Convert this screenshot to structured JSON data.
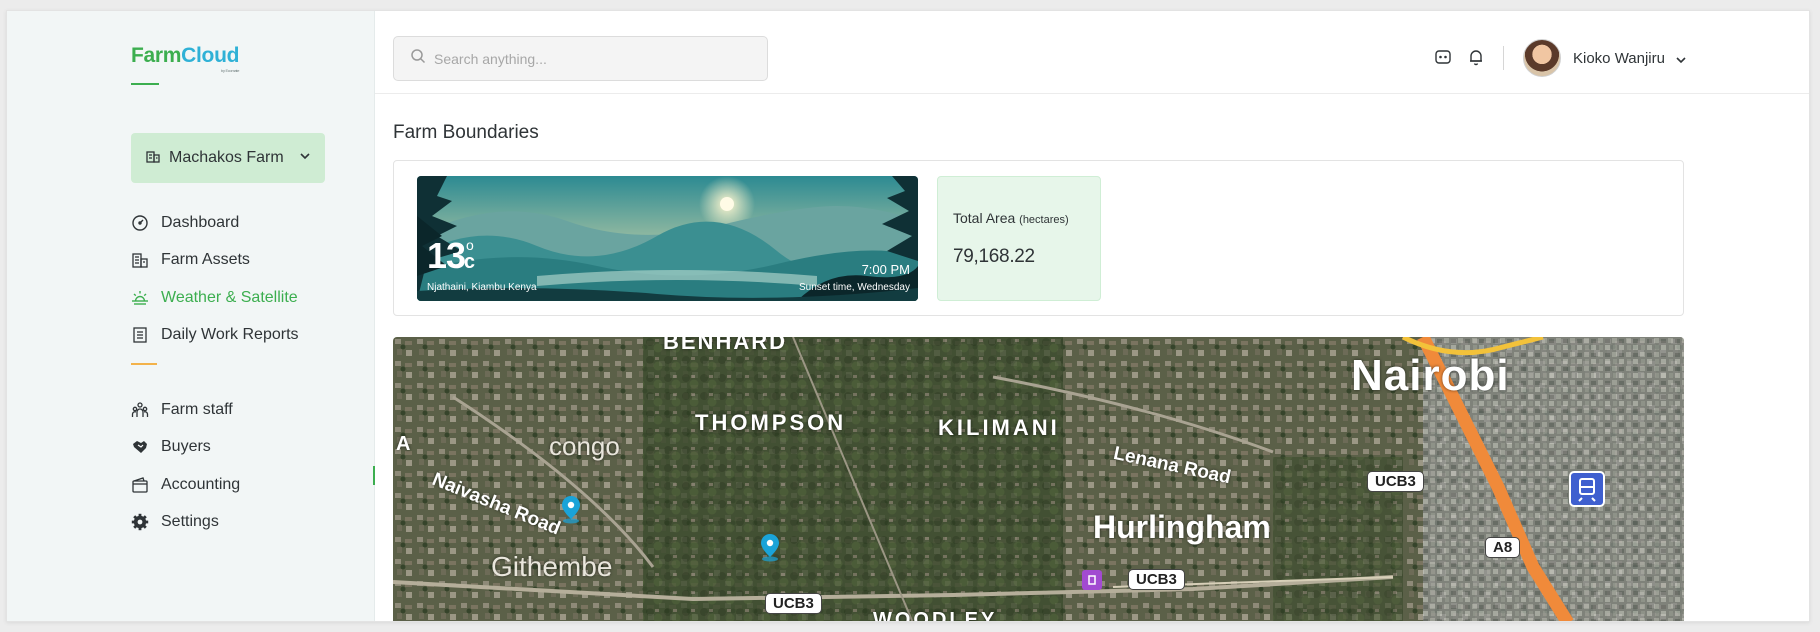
{
  "app": {
    "logo_farm": "Farm",
    "logo_cloud": "Cloud",
    "logo_by": "by Ecomate"
  },
  "sidebar": {
    "farm_selector": "Machakos Farm",
    "items": [
      {
        "label": "Dashboard",
        "icon": "dashboard-icon"
      },
      {
        "label": "Farm Assets",
        "icon": "building-icon"
      },
      {
        "label": "Weather & Satellite",
        "icon": "sun-icon",
        "active": true
      },
      {
        "label": "Daily Work Reports",
        "icon": "report-icon"
      }
    ],
    "items2": [
      {
        "label": "Farm staff",
        "icon": "staff-icon"
      },
      {
        "label": "Buyers",
        "icon": "handshake-icon"
      },
      {
        "label": "Accounting",
        "icon": "wallet-icon"
      },
      {
        "label": "Settings",
        "icon": "gear-icon"
      }
    ]
  },
  "header": {
    "search_placeholder": "Search anything...",
    "user_name": "Kioko Wanjiru"
  },
  "page": {
    "title": "Farm Boundaries"
  },
  "weather": {
    "temperature": "13",
    "degree": "o",
    "unit": "c",
    "location": "Njathaini, Kiambu Kenya",
    "time": "7:00 PM",
    "sunset_label": "Sunset time, Wednesday"
  },
  "area": {
    "label": "Total Area",
    "unit": "(hectares)",
    "value": "79,168.22"
  },
  "map": {
    "labels": [
      "BENHARD",
      "THOMPSON",
      "KILIMANI",
      "congo",
      "Naivasha Road",
      "Lenana Road",
      "Nairobi",
      "Hurlingham",
      "Githembe",
      "WOODLEY",
      "A"
    ],
    "shields": [
      "UCB3",
      "UCB3",
      "UCB3",
      "A8"
    ]
  },
  "colors": {
    "accent": "#3cae4f",
    "brand_blue": "#2fb1d6",
    "separator": "#f3b24a"
  }
}
